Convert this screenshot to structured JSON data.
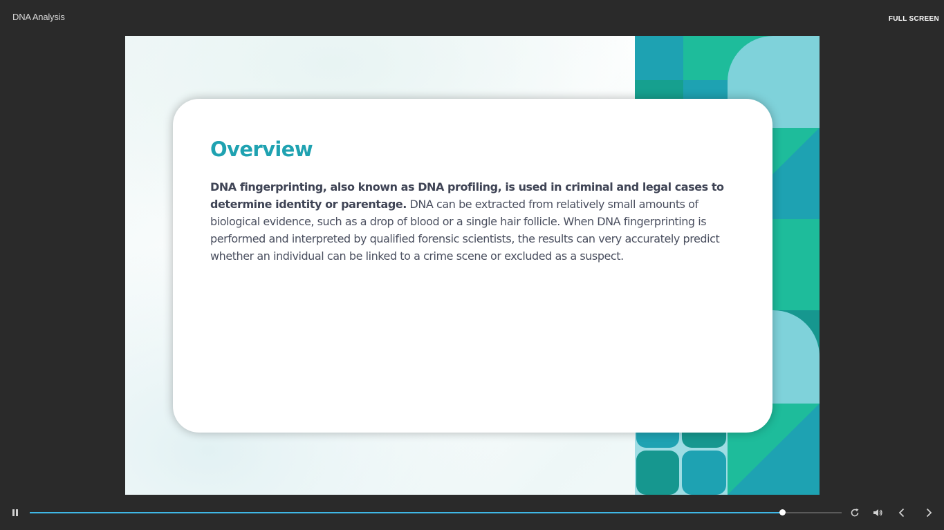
{
  "app": {
    "title": "DNA Analysis",
    "fullscreen_label": "FULL SCREEN"
  },
  "slide": {
    "title": "Overview",
    "body_bold": "DNA fingerprinting, also known as DNA profiling, is used in criminal and legal cases to determine identity or parentage.",
    "body_regular": " DNA can be extracted from relatively small amounts of biological evidence, such as a drop of blood or a single hair follicle. When DNA fingerprinting is performed and interpreted by qualified forensic scientists, the results can very accurately predict whether an individual can be linked to a crime scene or excluded as a suspect."
  },
  "player": {
    "progress_fraction": 0.928,
    "icons": {
      "play_pause": "pause-icon",
      "replay": "replay-icon",
      "volume": "volume-icon",
      "prev": "chevron-left-icon",
      "next": "chevron-right-icon"
    }
  },
  "colors": {
    "accent": "#1fa2b1",
    "progress": "#3fb7e6",
    "teal_dark": "#16978f",
    "teal": "#1ea2b2",
    "green": "#1ebc9b",
    "light_teal": "#7fd2da"
  }
}
